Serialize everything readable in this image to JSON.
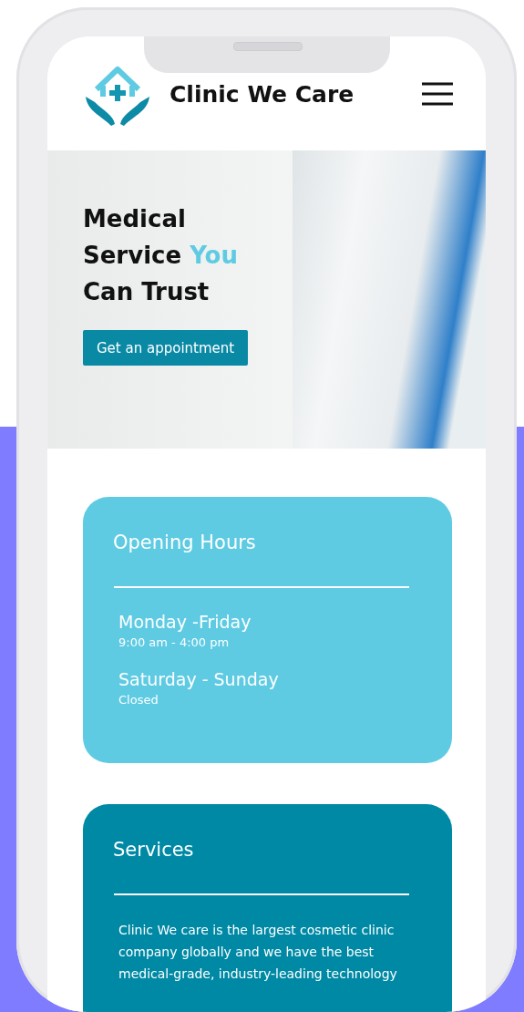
{
  "header": {
    "title": "Clinic We Care"
  },
  "hero": {
    "heading": [
      {
        "text": "Medical Service ",
        "highlight": false
      },
      {
        "text": "You",
        "highlight": true
      },
      {
        "text": " Can Trust",
        "highlight": false
      }
    ],
    "button": "Get an appointment"
  },
  "cards": [
    {
      "kind": "hours",
      "title": "Opening Hours",
      "color": "#5ecbe3",
      "entries": [
        {
          "days": "Monday -Friday",
          "hours": "9:00 am - 4:00  pm"
        },
        {
          "days": "Saturday - Sunday",
          "hours": "Closed"
        }
      ]
    },
    {
      "kind": "text",
      "title": "Services",
      "color": "#0089a5",
      "text": "Clinic We care is the largest cosmetic clinic company globally and we have the best medical-grade, industry-leading technology"
    }
  ]
}
